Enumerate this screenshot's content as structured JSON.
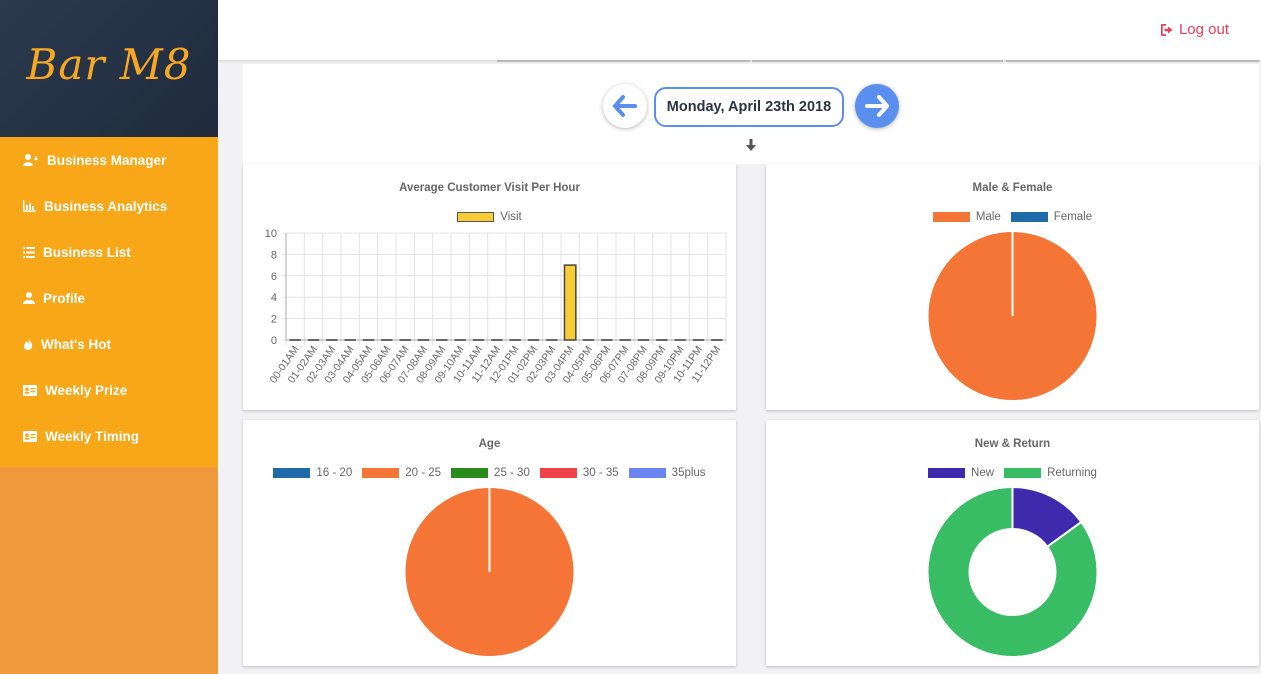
{
  "app": {
    "logo": "Bar M8"
  },
  "sidebar": {
    "items": [
      {
        "label": "Business Manager",
        "icon": "user-plus-icon"
      },
      {
        "label": "Business Analytics",
        "icon": "bar-chart-icon"
      },
      {
        "label": "Business List",
        "icon": "list-icon"
      },
      {
        "label": "Profile",
        "icon": "user-icon"
      },
      {
        "label": "What's Hot",
        "icon": "fire-icon"
      },
      {
        "label": "Weekly Prize",
        "icon": "id-card-icon"
      },
      {
        "label": "Weekly Timing",
        "icon": "id-card-icon"
      }
    ]
  },
  "header": {
    "logout_label": "Log out"
  },
  "date_nav": {
    "current_date": "Monday, April 23th 2018"
  },
  "colors": {
    "accent": "#5b8fef",
    "sidebar": "#f8a718",
    "logout": "#e83e5a"
  },
  "charts": {
    "visits": {
      "title": "Average Customer Visit Per Hour",
      "legend": [
        {
          "label": "Visit",
          "color": "#f9cc35"
        }
      ]
    },
    "gender": {
      "title": "Male & Female",
      "legend": [
        {
          "label": "Male",
          "color": "#f47535"
        },
        {
          "label": "Female",
          "color": "#1f6aa8"
        }
      ]
    },
    "age": {
      "title": "Age",
      "legend": [
        {
          "label": "16 - 20",
          "color": "#1f6aa8"
        },
        {
          "label": "20 - 25",
          "color": "#f47535"
        },
        {
          "label": "25 - 30",
          "color": "#2a8a1c"
        },
        {
          "label": "30 - 35",
          "color": "#f0404a"
        },
        {
          "label": "35plus",
          "color": "#6a84f2"
        }
      ]
    },
    "newreturn": {
      "title": "New & Return",
      "legend": [
        {
          "label": "New",
          "color": "#3f2aad"
        },
        {
          "label": "Returning",
          "color": "#38bd64"
        }
      ]
    }
  },
  "chart_data": [
    {
      "type": "bar",
      "title": "Average Customer Visit Per Hour",
      "categories": [
        "00-01AM",
        "01-02AM",
        "02-03AM",
        "03-04AM",
        "04-05AM",
        "05-06AM",
        "06-07AM",
        "07-08AM",
        "08-09AM",
        "09-10AM",
        "10-11AM",
        "11-12AM",
        "12-01PM",
        "01-02PM",
        "02-03PM",
        "03-04PM",
        "04-05PM",
        "05-06PM",
        "06-07PM",
        "07-08PM",
        "08-09PM",
        "09-10PM",
        "10-11PM",
        "11-12PM"
      ],
      "series": [
        {
          "name": "Visit",
          "values": [
            0,
            0,
            0,
            0,
            0,
            0,
            0,
            0,
            0,
            0,
            0,
            0,
            0,
            0,
            0,
            7,
            0,
            0,
            0,
            0,
            0,
            0,
            0,
            0
          ]
        }
      ],
      "yticks": [
        0,
        2,
        4,
        6,
        8,
        10
      ],
      "ylim": [
        0,
        10
      ],
      "grid": true,
      "legend_position": "top"
    },
    {
      "type": "pie",
      "title": "Male & Female",
      "labels": [
        "Male",
        "Female"
      ],
      "values": [
        100,
        0
      ]
    },
    {
      "type": "pie",
      "title": "Age",
      "labels": [
        "16 - 20",
        "20 - 25",
        "25 - 30",
        "30 - 35",
        "35plus"
      ],
      "values": [
        0,
        100,
        0,
        0,
        0
      ]
    },
    {
      "type": "pie",
      "title": "New & Return",
      "labels": [
        "New",
        "Returning"
      ],
      "values": [
        15,
        85
      ]
    }
  ]
}
